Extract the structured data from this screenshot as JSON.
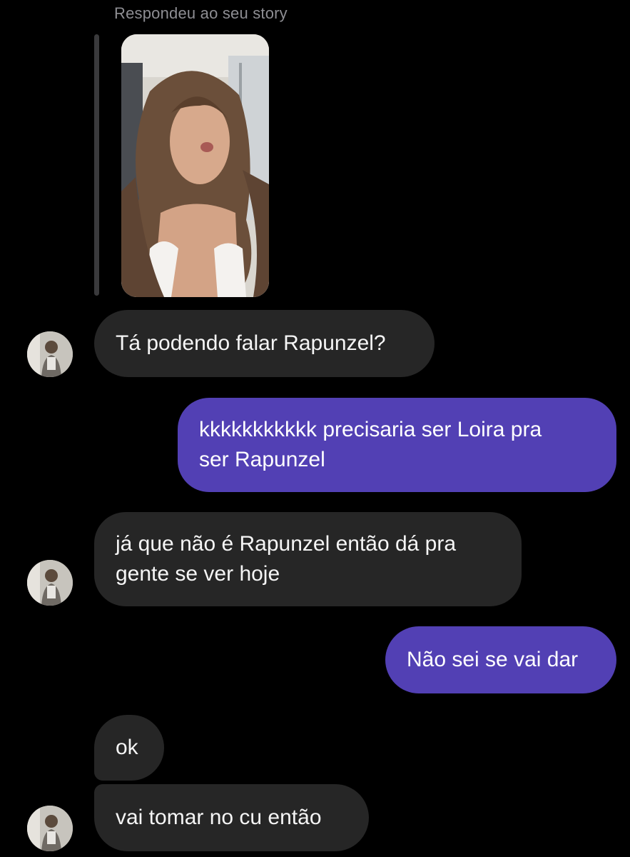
{
  "story_reply": {
    "caption": "Respondeu ao seu story",
    "thumbnail_icon": "story-photo"
  },
  "messages": [
    {
      "sender": "them",
      "text": "Tá podendo falar Rapunzel?"
    },
    {
      "sender": "me",
      "text": "kkkkkkkkkkk precisaria ser Loira pra\nser Rapunzel"
    },
    {
      "sender": "them",
      "text": "já que não é Rapunzel então dá pra\ngente se ver hoje"
    },
    {
      "sender": "me",
      "text": "Não sei se vai dar"
    },
    {
      "sender": "them",
      "text": "ok"
    },
    {
      "sender": "them",
      "text": "vai tomar no cu então"
    }
  ],
  "colors": {
    "background": "#000000",
    "incoming_bubble": "#262626",
    "outgoing_bubble": "#5240b4",
    "caption": "#8e8e93"
  }
}
